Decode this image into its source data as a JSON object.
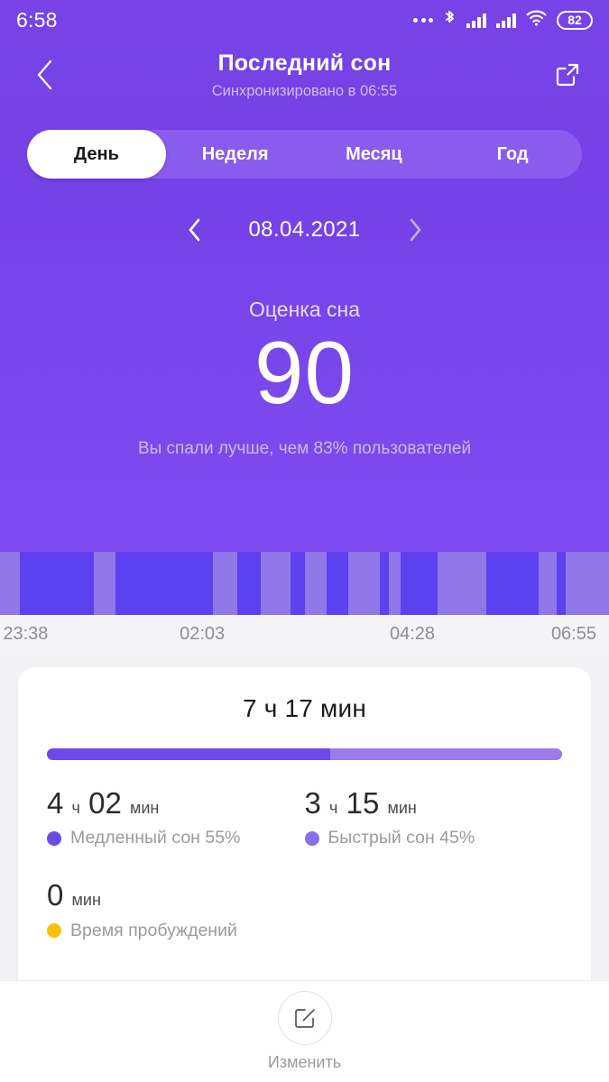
{
  "statusbar": {
    "time": "6:58",
    "battery": "82",
    "icons": [
      "more-dots-icon",
      "bluetooth-icon",
      "signal-sim1-icon",
      "signal-sim2-icon",
      "wifi-icon",
      "battery-icon"
    ]
  },
  "header": {
    "back_icon": "chevron-left-icon",
    "title": "Последний сон",
    "subtitle": "Синхронизировано в 06:55",
    "share_icon": "share-external-icon"
  },
  "tabs": [
    {
      "label": "День",
      "active": true
    },
    {
      "label": "Неделя",
      "active": false
    },
    {
      "label": "Месяц",
      "active": false
    },
    {
      "label": "Год",
      "active": false
    }
  ],
  "datenav": {
    "prev_icon": "chevron-left-icon",
    "date": "08.04.2021",
    "next_icon": "chevron-right-icon"
  },
  "score": {
    "label": "Оценка сна",
    "value": "90",
    "note": "Вы спали лучше, чем 83% пользователей"
  },
  "colors": {
    "hero_purple": "#7743e6",
    "tab_track": "#8a5cee",
    "deep_sleep": "#5b41f0",
    "light_sleep": "#9178e8",
    "awake": "#ffc107",
    "progress_deep": "#6b4ae8",
    "progress_light": "#9b7ceb"
  },
  "chart_data": {
    "type": "bar",
    "title": "Hypnogram — Последний сон 08.04.2021",
    "xlabel": "",
    "ylabel": "",
    "grid": false,
    "legend_position": "below-card",
    "x_axis_ticks": [
      "23:38",
      "02:03",
      "04:28",
      "06:55"
    ],
    "x_axis_tick_positions_pct": [
      0.5,
      29.5,
      64.0,
      95.5
    ],
    "start_time": "23:38",
    "end_time": "06:55",
    "categories": [
      "light",
      "deep",
      "light",
      "deep",
      "light",
      "deep",
      "light",
      "deep",
      "light",
      "deep",
      "light",
      "deep",
      "light",
      "deep",
      "light",
      "deep",
      "light",
      "deep",
      "light",
      "deep",
      "light"
    ],
    "series": [
      {
        "name": "sleep-stage-bands",
        "segments": [
          {
            "stage": "light",
            "start_pct": 0.0,
            "width_pct": 6.2,
            "color": "#9178e8"
          },
          {
            "stage": "deep",
            "start_pct": 6.2,
            "width_pct": 22.5,
            "color": "#5b41f0"
          },
          {
            "stage": "light",
            "start_pct": 28.7,
            "width_pct": 6.4,
            "color": "#9178e8"
          },
          {
            "stage": "deep",
            "start_pct": 35.1,
            "width_pct": 29.9,
            "color": "#5b41f0"
          },
          {
            "stage": "light",
            "start_pct": 65.0,
            "width_pct": 7.4,
            "color": "#9178e8"
          },
          {
            "stage": "deep",
            "start_pct": 72.4,
            "width_pct": 7.4,
            "color": "#5b41f0"
          },
          {
            "stage": "light",
            "start_pct": 79.8,
            "width_pct": 8.9,
            "color": "#9178e8"
          },
          {
            "stage": "deep",
            "start_pct": 88.7,
            "width_pct": 4.5,
            "color": "#5b41f0"
          },
          {
            "stage": "light",
            "start_pct": 93.2,
            "width_pct": 6.7,
            "color": "#9178e8"
          },
          {
            "stage": "deep",
            "start_pct": 99.9,
            "width_pct": 6.7,
            "color": "#5b41f0"
          },
          {
            "stage": "light",
            "start_pct": 106.6,
            "width_pct": 9.6,
            "color": "#9178e8"
          },
          {
            "stage": "deep",
            "start_pct": 116.2,
            "width_pct": 8.9,
            "color": "#5b41f0"
          },
          {
            "stage": "light",
            "start_pct": 125.1,
            "width_pct": 3.7,
            "color": "#9178e8"
          },
          {
            "stage": "deep",
            "start_pct": 128.8,
            "width_pct": 11.1,
            "color": "#5b41f0"
          },
          {
            "stage": "light",
            "start_pct": 139.9,
            "width_pct": 14.8,
            "color": "#9178e8"
          },
          {
            "stage": "deep",
            "start_pct": 154.7,
            "width_pct": 16.3,
            "color": "#5b41f0"
          },
          {
            "stage": "light",
            "start_pct": 171.0,
            "width_pct": 5.2,
            "color": "#9178e8"
          },
          {
            "stage": "deep",
            "start_pct": 176.2,
            "width_pct": 3.0,
            "color": "#5b41f0"
          },
          {
            "stage": "light",
            "start_pct": 179.2,
            "width_pct": 13.0,
            "color": "#9178e8"
          }
        ]
      }
    ],
    "bands_render": [
      {
        "stage": "light",
        "w": 4.1
      },
      {
        "stage": "deep",
        "w": 15.0
      },
      {
        "stage": "light",
        "w": 4.3
      },
      {
        "stage": "deep",
        "w": 19.9
      },
      {
        "stage": "light",
        "w": 4.9
      },
      {
        "stage": "deep",
        "w": 4.9
      },
      {
        "stage": "light",
        "w": 5.9
      },
      {
        "stage": "deep",
        "w": 3.0
      },
      {
        "stage": "light",
        "w": 4.4
      },
      {
        "stage": "deep",
        "w": 4.4
      },
      {
        "stage": "light",
        "w": 6.4
      },
      {
        "stage": "deep",
        "w": 1.8
      },
      {
        "stage": "light",
        "w": 2.5
      },
      {
        "stage": "deep",
        "w": 7.4
      },
      {
        "stage": "light",
        "w": 9.9
      },
      {
        "stage": "deep",
        "w": 10.8
      },
      {
        "stage": "light",
        "w": 3.5
      },
      {
        "stage": "deep",
        "w": 2.0
      },
      {
        "stage": "light",
        "w": 8.7
      }
    ]
  },
  "card": {
    "total": "7 ч 17 мин",
    "progress": {
      "deep_pct": 55,
      "light_pct": 45
    },
    "stats": [
      {
        "value_num": "4",
        "value_unit_h": "ч",
        "value_num2": "02",
        "value_unit_m": "мин",
        "legend": "Медленный сон 55%",
        "color": "#6b4ae8",
        "dot_name": "deep-sleep-dot"
      },
      {
        "value_num": "3",
        "value_unit_h": "ч",
        "value_num2": "15",
        "value_unit_m": "мин",
        "legend": "Быстрый сон 45%",
        "color": "#8a6cee",
        "dot_name": "light-sleep-dot"
      },
      {
        "value_num": "0",
        "value_unit_h": "",
        "value_num2": "",
        "value_unit_m": "мин",
        "legend": "Время пробуждений",
        "color": "#ffc107",
        "dot_name": "awake-dot"
      }
    ]
  },
  "bottombar": {
    "edit_icon": "edit-square-pencil-icon",
    "edit_label": "Изменить"
  }
}
